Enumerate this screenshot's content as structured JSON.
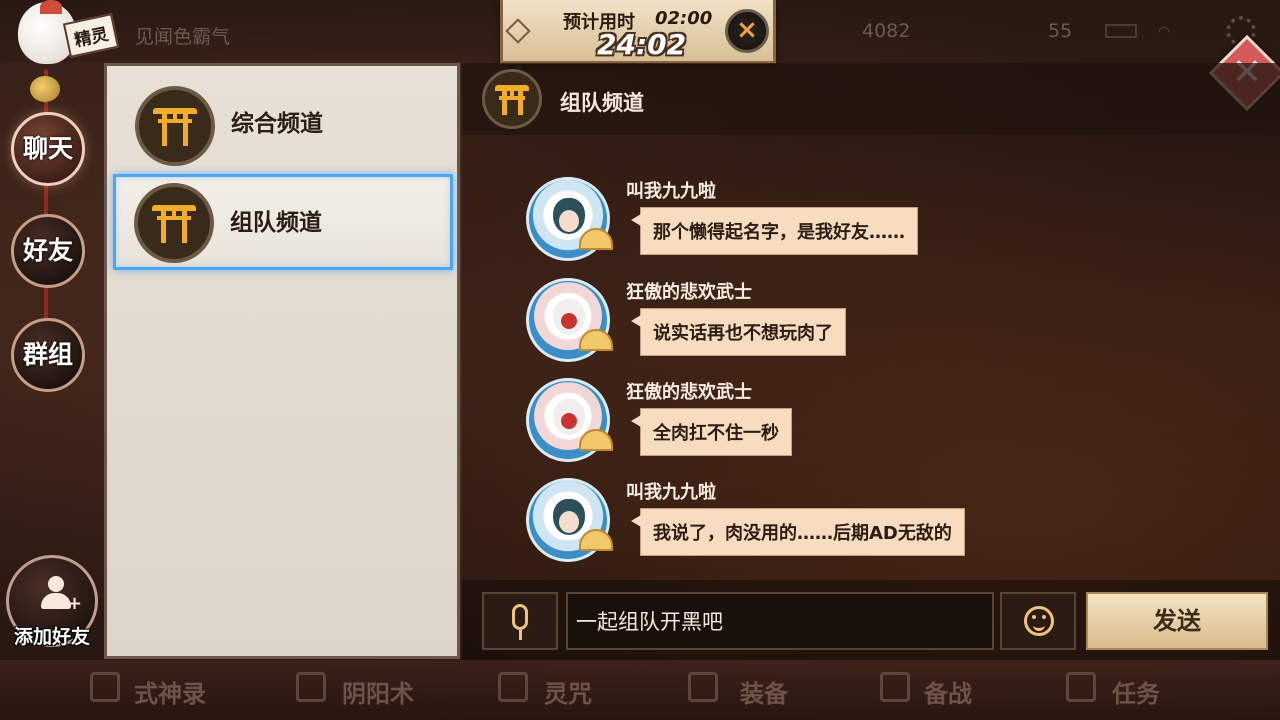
{
  "hud": {
    "player_title": "见闻色霸气",
    "sprite_label": "精灵",
    "stat_1": "4082",
    "stat_2": "55"
  },
  "timer": {
    "label": "预计用时",
    "estimate": "02:00",
    "elapsed": "24:02",
    "close_label": "×"
  },
  "close_button_label": "✕",
  "side_nav": [
    {
      "label": "聊天",
      "active": true
    },
    {
      "label": "好友",
      "active": false
    },
    {
      "label": "群组",
      "active": false
    }
  ],
  "add_friend_label": "添加好友",
  "channels": [
    {
      "name": "综合频道",
      "selected": false
    },
    {
      "name": "组队频道",
      "selected": true
    }
  ],
  "chat": {
    "title": "组队频道",
    "messages": [
      {
        "sender": "叫我九九啦",
        "text": "那个懒得起名字，是我好友……"
      },
      {
        "sender": "狂傲的悲欢武士",
        "text": "说实话再也不想玩肉了"
      },
      {
        "sender": "狂傲的悲欢武士",
        "text": "全肉扛不住一秒"
      },
      {
        "sender": "叫我九九啦",
        "text": "我说了，肉没用的……后期AD无敌的"
      }
    ]
  },
  "input": {
    "value": "一起组队开黑吧",
    "send_label": "发送"
  },
  "bottom_nav": [
    "式神录",
    "阴阳术",
    "灵咒",
    "装备",
    "备战",
    "任务"
  ]
}
